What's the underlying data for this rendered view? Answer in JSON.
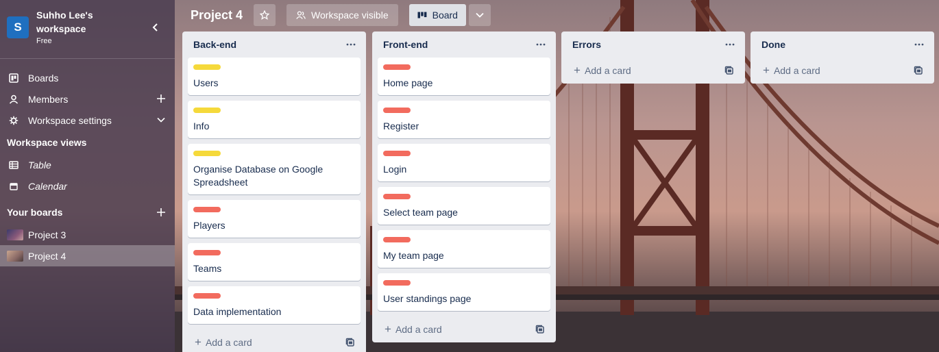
{
  "workspace": {
    "initial": "S",
    "name": "Suhho Lee's workspace",
    "plan": "Free"
  },
  "sidebar": {
    "nav": [
      {
        "label": "Boards",
        "icon": "board-icon"
      },
      {
        "label": "Members",
        "icon": "person-icon",
        "action": "plus-icon"
      },
      {
        "label": "Workspace settings",
        "icon": "gear-icon",
        "action": "chevron-down-icon"
      }
    ],
    "views_heading": "Workspace views",
    "views": [
      {
        "label": "Table",
        "icon": "table-icon"
      },
      {
        "label": "Calendar",
        "icon": "calendar-icon"
      }
    ],
    "boards_heading": "Your boards",
    "boards": [
      {
        "label": "Project 3",
        "active": false
      },
      {
        "label": "Project 4",
        "active": true
      }
    ]
  },
  "header": {
    "title": "Project 4",
    "visibility": "Workspace visible",
    "view": "Board"
  },
  "colors": {
    "yellow_label": "#f5d93b",
    "red_label": "#f26b5e",
    "logo": "#1f6fbf"
  },
  "lists": [
    {
      "title": "Back-end",
      "cards": [
        {
          "title": "Users",
          "label": "yellow"
        },
        {
          "title": "Info",
          "label": "yellow"
        },
        {
          "title": "Organise Database on Google Spreadsheet",
          "label": "yellow"
        },
        {
          "title": "Players",
          "label": "red"
        },
        {
          "title": "Teams",
          "label": "red"
        },
        {
          "title": "Data implementation",
          "label": "red"
        }
      ],
      "add_label": "Add a card"
    },
    {
      "title": "Front-end",
      "cards": [
        {
          "title": "Home page",
          "label": "red"
        },
        {
          "title": "Register",
          "label": "red"
        },
        {
          "title": "Login",
          "label": "red"
        },
        {
          "title": "Select team page",
          "label": "red"
        },
        {
          "title": "My team page",
          "label": "red"
        },
        {
          "title": "User standings page",
          "label": "red"
        }
      ],
      "add_label": "Add a card"
    },
    {
      "title": "Errors",
      "cards": [],
      "add_label": "Add a card"
    },
    {
      "title": "Done",
      "cards": [],
      "add_label": "Add a card"
    }
  ]
}
